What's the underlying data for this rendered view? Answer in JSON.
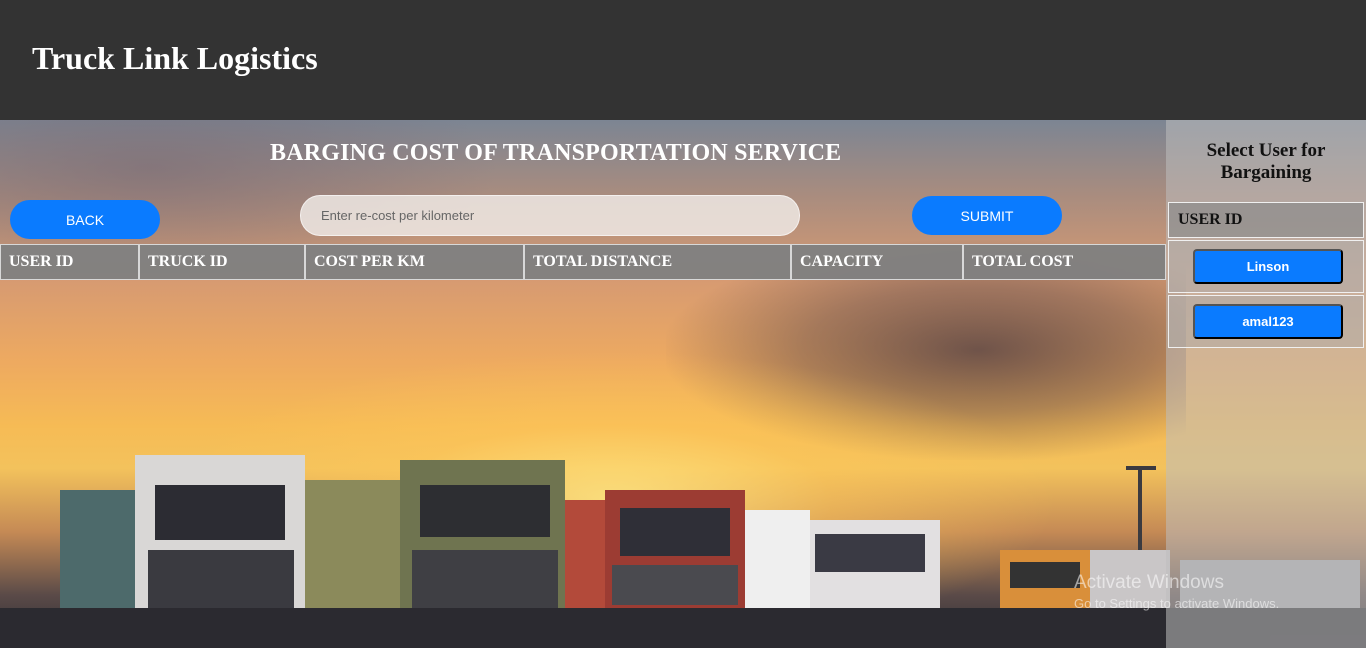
{
  "header": {
    "brand": "Truck Link Logistics"
  },
  "main": {
    "title": "BARGING COST OF TRANSPORTATION SERVICE",
    "back_label": "BACK",
    "submit_label": "SUBMIT",
    "cost_input": {
      "placeholder": "Enter re-cost per kilometer",
      "value": ""
    },
    "table": {
      "columns": [
        "USER ID",
        "TRUCK ID",
        "COST PER KM",
        "TOTAL DISTANCE",
        "CAPACITY",
        "TOTAL COST"
      ],
      "rows": []
    }
  },
  "sidebar": {
    "title": "Select User for Bargaining",
    "column": "USER ID",
    "users": [
      "Linson",
      "amal123"
    ]
  },
  "watermark": {
    "line1": "Activate Windows",
    "line2": "Go to Settings to activate Windows."
  },
  "colors": {
    "header_bg": "#333333",
    "button": "#0a7bff",
    "table_header": "#808080"
  }
}
